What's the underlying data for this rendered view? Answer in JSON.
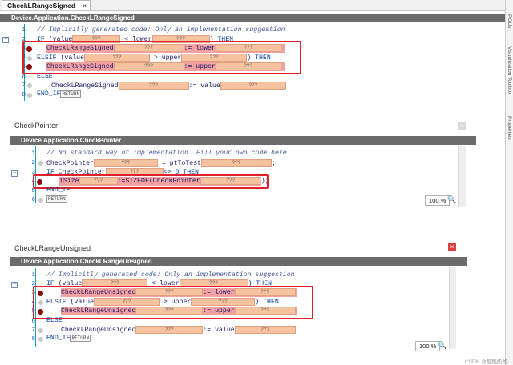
{
  "tab": {
    "label": "CheckLRangeSigned",
    "close": "×"
  },
  "panel1": {
    "header": "Device.Application.CheckLRangeSigned",
    "lines": [
      {
        "n": "1",
        "comment": "// Implicitly generated code: Only an implementation suggestion"
      },
      {
        "n": "2",
        "a": "IF",
        "b": "(value",
        "c": "< lower",
        "d": ") THEN"
      },
      {
        "n": "3",
        "a": "CheckLRangeSigned",
        "b": ":= lower"
      },
      {
        "n": "4",
        "a": "ELSIF",
        "b": "(value",
        "c": "> upper",
        "d": ") THEN"
      },
      {
        "n": "5",
        "a": "CheckLRangeSigned",
        "b": ":= upper"
      },
      {
        "n": "6",
        "a": "ELSE"
      },
      {
        "n": "7",
        "a": "CheckLRangeSigned",
        "b": ":= value"
      },
      {
        "n": "8",
        "a": "END_IF",
        "ret": "RETURN"
      }
    ]
  },
  "redacted": "???",
  "panel2": {
    "title": "CheckPointer",
    "header": "Device.Application.CheckPointer",
    "lines": [
      {
        "n": "1",
        "comment": "// No standard way of implementation. Fill your own code here"
      },
      {
        "n": "2",
        "a": "CheckPointer",
        "b": ":= ptToTest"
      },
      {
        "n": "3",
        "a": "IF",
        "b": "CheckPointer",
        "c": "<> 0 THEN"
      },
      {
        "n": "4",
        "a": "iSize",
        "b": ":=SIZEOF(CheckPointer"
      },
      {
        "n": "5",
        "a": "END_IF"
      },
      {
        "n": "6",
        "ret": "RETURN"
      }
    ],
    "zoom": "100 %"
  },
  "panel3": {
    "title": "CheckLRangeUnsigned",
    "header": "Device.Application.CheckLRangeUnsigned",
    "lines": [
      {
        "n": "1",
        "comment": "// Implicitly generated code: Only an implementation suggestion"
      },
      {
        "n": "2",
        "a": "IF",
        "b": "(value",
        "c": "< lower",
        "d": ") THEN"
      },
      {
        "n": "3",
        "a": "CheckLRangeUnsigned",
        "b": ":= lower"
      },
      {
        "n": "4",
        "a": "ELSIF",
        "b": "(value",
        "c": "> upper",
        "d": ") THEN"
      },
      {
        "n": "5",
        "a": "CheckLRangeUnsigned",
        "b": ":= upper"
      },
      {
        "n": "6",
        "a": "ELSE"
      },
      {
        "n": "7",
        "a": "CheckLRangeUnsigned",
        "b": ":= value"
      },
      {
        "n": "8",
        "a": "END_IF",
        "ret": "RETURN"
      }
    ],
    "zoom": "100 %"
  },
  "rightbar": {
    "items": [
      "POUs",
      "Visualization Toolbox",
      "Properties"
    ]
  },
  "watermark": "CSDN @酷酷奶爸"
}
